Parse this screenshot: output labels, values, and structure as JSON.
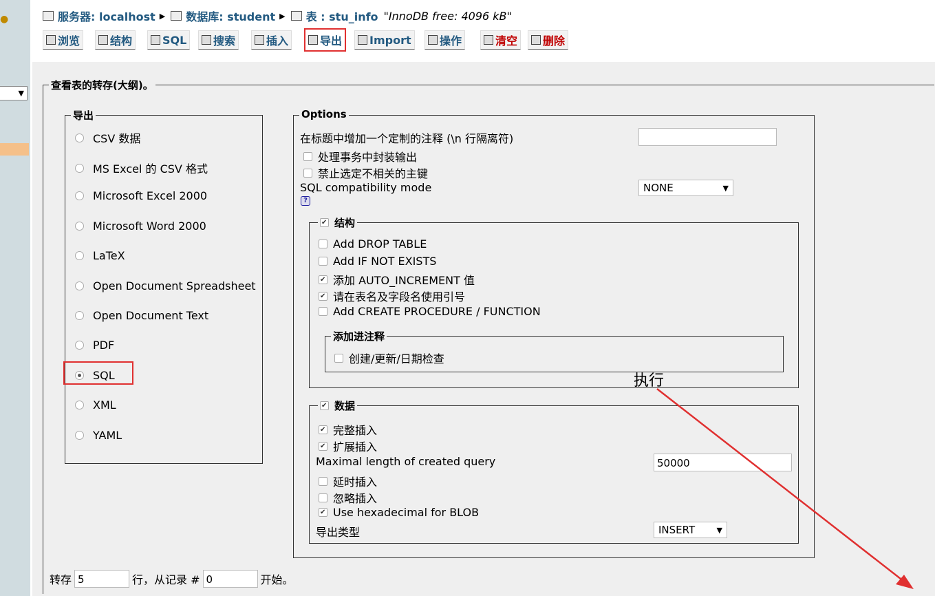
{
  "breadcrumb": {
    "server": "服务器: localhost",
    "database": "数据库: student",
    "table": "表 : stu_info",
    "free": "\"InnoDB free: 4096 kB\""
  },
  "tabs": [
    {
      "label": "浏览",
      "icon": "browse-icon"
    },
    {
      "label": "结构",
      "icon": "structure-icon"
    },
    {
      "label": "SQL",
      "icon": "sql-icon"
    },
    {
      "label": "搜索",
      "icon": "search-icon"
    },
    {
      "label": "插入",
      "icon": "insert-icon"
    },
    {
      "label": "导出",
      "icon": "export-icon",
      "active": true
    },
    {
      "label": "Import",
      "icon": "import-icon"
    },
    {
      "label": "操作",
      "icon": "operations-icon"
    },
    {
      "label": "清空",
      "icon": "empty-icon"
    },
    {
      "label": "删除",
      "icon": "drop-icon"
    }
  ],
  "main": {
    "legend": "查看表的转存(大纲)。"
  },
  "export": {
    "legend": "导出",
    "formats": [
      "CSV 数据",
      "MS Excel 的 CSV 格式",
      "Microsoft Excel 2000",
      "Microsoft Word 2000",
      "LaTeX",
      "Open Document Spreadsheet",
      "Open Document Text",
      "PDF",
      "SQL",
      "XML",
      "YAML"
    ],
    "selected": "SQL"
  },
  "options": {
    "legend": "Options",
    "header_comment_label": "在标题中增加一个定制的注释 (\\n 行隔离符)",
    "header_comment_value": "",
    "wrap_transaction": "处理事务中封装输出",
    "disable_fk": "禁止选定不相关的主键",
    "compat_label": "SQL compatibility mode",
    "compat_value": "NONE",
    "structure": {
      "legend": "结构",
      "drop_table": "Add DROP TABLE",
      "if_not_exists": "Add IF NOT EXISTS",
      "auto_increment": "添加 AUTO_INCREMENT 值",
      "backquotes": "请在表名及字段名使用引号",
      "procedure": "Add CREATE PROCEDURE / FUNCTION",
      "comments_legend": "添加进注释",
      "dates": "创建/更新/日期检查"
    },
    "data": {
      "legend": "数据",
      "complete_inserts": "完整插入",
      "extended_inserts": "扩展插入",
      "max_query_label": "Maximal length of created query",
      "max_query_value": "50000",
      "delayed": "延时插入",
      "ignore": "忽略插入",
      "hex_blob": "Use hexadecimal for BLOB",
      "export_type_label": "导出类型",
      "export_type_value": "INSERT"
    }
  },
  "footer": {
    "prefix": "转存",
    "rows_value": "5",
    "middle": "行，从记录 #",
    "start_value": "0",
    "suffix": "开始。"
  },
  "annotation": "执行",
  "colors": {
    "link": "#235a81",
    "panel": "#efefef",
    "highlight": "#e03030"
  }
}
